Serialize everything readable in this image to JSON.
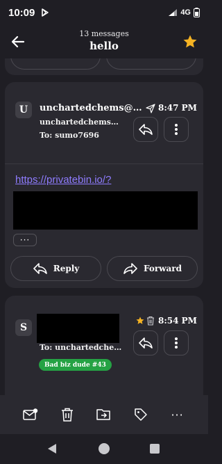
{
  "status": {
    "time": "10:09",
    "network": "4G"
  },
  "header": {
    "message_count": "13 messages",
    "title": "hello"
  },
  "messages": [
    {
      "avatar": "S",
      "sender": "",
      "to": "To: unchartedchem…",
      "time": "8:54 PM",
      "starred": true,
      "label": "Bad biz dude #43"
    }
  ],
  "expanded_message": {
    "avatar": "U",
    "sender": "unchartedchems@pr…",
    "sender_detail": "unchartedchems@p…",
    "to": "To: sumo7696",
    "time": "8:47 PM",
    "link": "https://privatebin.io/?",
    "more_label": "···",
    "reply_label": "Reply",
    "forward_label": "Forward"
  },
  "toolbar": {
    "items": [
      "mark-unread",
      "delete",
      "move",
      "label",
      "more"
    ],
    "more_label": "···"
  },
  "colors": {
    "accent": "#8f7cff",
    "star": "#f5b323",
    "label": "#25a244",
    "background": "#1f1e24",
    "card": "#2a2930"
  }
}
